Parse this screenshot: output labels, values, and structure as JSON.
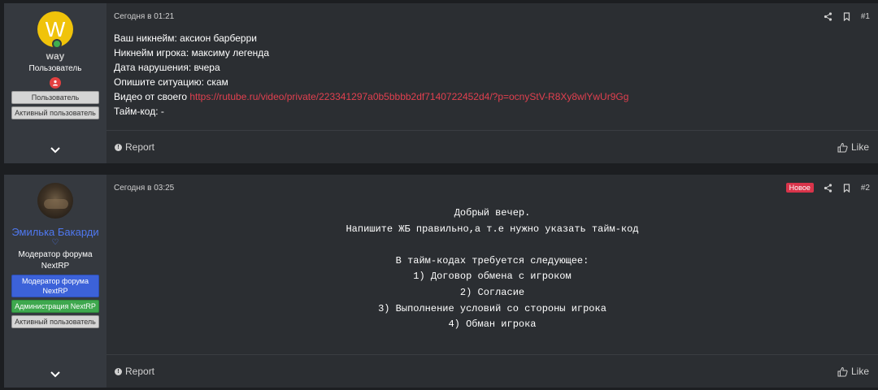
{
  "posts": [
    {
      "author": {
        "avatar_letter": "W",
        "avatar_color": "#f0c30a",
        "name": "way",
        "title": "Пользователь",
        "banners": [
          "Пользователь",
          "Активный пользователь"
        ]
      },
      "date": "Сегодня в 01:21",
      "number": "#1",
      "lines": [
        "Ваш никнейм: аксион барберри",
        "Никнейм игрока: максиму легенда",
        "Дата нарушения: вчера",
        "Опишите ситуацию: скам"
      ],
      "video_prefix": "Видео от своего ",
      "video_link": "https://rutube.ru/video/private/223341297a0b5bbbb2df7140722452d4/?p=ocnyStV-R8Xy8wlYwUr9Gg",
      "timecode_line": "Тайм-код: -",
      "report_label": "Report",
      "like_label": "Like"
    },
    {
      "author": {
        "name": "Эмилька Бакарди",
        "name_color": "#4f78f0",
        "title": "Модератор форума NextRP",
        "banners": [
          "Модератор форума NextRP",
          "Администрация NextRP",
          "Активный пользователь"
        ]
      },
      "date": "Сегодня в 03:25",
      "badge": "Новое",
      "number": "#2",
      "body": "Добрый вечер.\nНапишите ЖБ правильно,а т.е нужно указать тайм-код\n\nВ тайм-кодах требуется следующее:\n1) Договор обмена с игроком\n2) Согласие\n3) Выполнение условий со стороны игрока\n4) Обман игрока",
      "report_label": "Report",
      "like_label": "Like"
    }
  ],
  "icons": {
    "share": "share-icon",
    "bookmark": "bookmark-icon",
    "expand": "chevron-down-icon",
    "like": "thumbs-up-icon",
    "report": "info-icon",
    "online": "online-status-icon",
    "role": "user-role-icon",
    "heart": "heart-icon"
  },
  "colors": {
    "link": "#e0404f",
    "new_badge": "#d9344a",
    "banner_moderator": "#3c62d9",
    "banner_admin": "#3ea84e"
  }
}
